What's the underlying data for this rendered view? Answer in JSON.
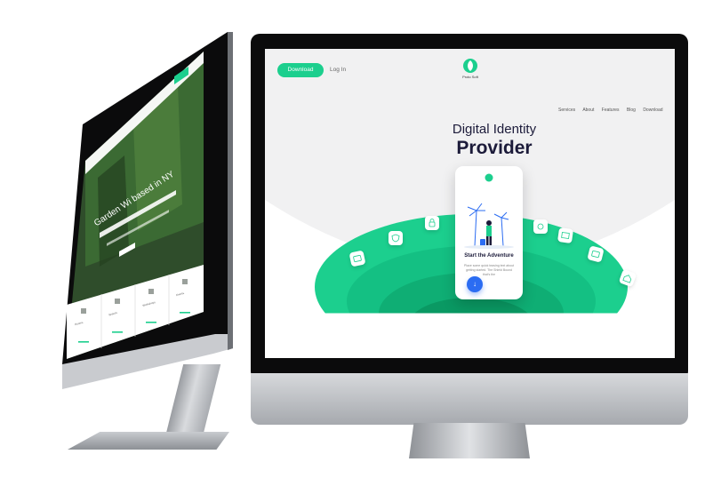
{
  "colors": {
    "accent": "#1ccf8e",
    "accent_dark": "#0fae74",
    "hero_text": "#1c1b3a",
    "scroll_button": "#2b6cf2",
    "left_site_green": "#2e5a2c"
  },
  "right_site": {
    "nav": {
      "download_label": "Download",
      "login_label": "Log In",
      "links": [
        "Services",
        "About",
        "Features",
        "Blog",
        "Download"
      ]
    },
    "logo": {
      "icon": "leaf-logo-icon",
      "text": "Proto Soft"
    },
    "hero": {
      "line1": "Digital Identity",
      "line2": "Provider"
    },
    "phone": {
      "title": "Start the Adventure",
      "body": "Place some quick teasing text about getting started. The Shield Bound that's the"
    },
    "scroll_icon": "arrow-down-icon"
  },
  "left_site": {
    "hero_title": "Garden Wi based in NY",
    "features": [
      "Rooms",
      "Spaces",
      "Workshops",
      "Events"
    ]
  }
}
